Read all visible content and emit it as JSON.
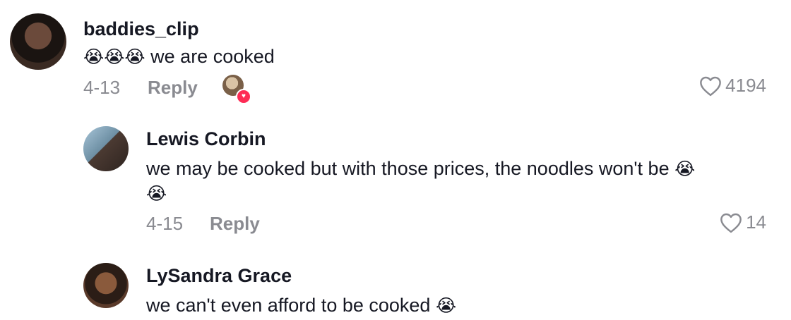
{
  "comments": [
    {
      "username": "baddies_clip",
      "emoji": "😭😭😭",
      "text": "we are cooked",
      "date": "4-13",
      "reply_label": "Reply",
      "like_count": "4194"
    },
    {
      "username": "Lewis Corbin",
      "text_line1": "we may be cooked but with those prices, the noodles won't be",
      "emoji_inline": "😭",
      "emoji_line2": "😭",
      "date": "4-15",
      "reply_label": "Reply",
      "like_count": "14"
    },
    {
      "username": "LySandra Grace",
      "text": "we can't even afford to be cooked",
      "emoji_inline": "😭"
    }
  ],
  "icons": {
    "like": "heart-outline-icon",
    "creator_liked": "heart-filled-icon"
  },
  "colors": {
    "username": "#161823",
    "meta": "#8a8b91",
    "creator_heart": "#fe2c55"
  }
}
